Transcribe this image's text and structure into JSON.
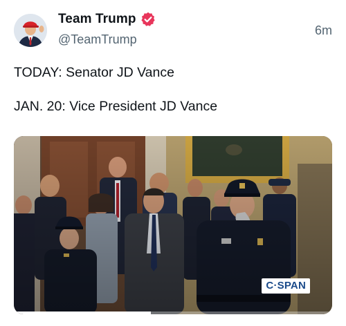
{
  "post": {
    "author": {
      "display_name": "Team Trump",
      "handle": "@TeamTrump",
      "avatar_icon": "profile-photo",
      "verified_icon": "verified-badge-icon",
      "verified_color": "#e8365b"
    },
    "timestamp": "6m",
    "text_lines": [
      "TODAY: Senator JD Vance",
      "JAN. 20: Vice President JD Vance"
    ],
    "media": {
      "type": "video",
      "watermark": "C·SPAN",
      "progress": 0.43
    }
  },
  "colors": {
    "text": "#0f1419",
    "secondary_text": "#536471",
    "background": "#ffffff"
  }
}
